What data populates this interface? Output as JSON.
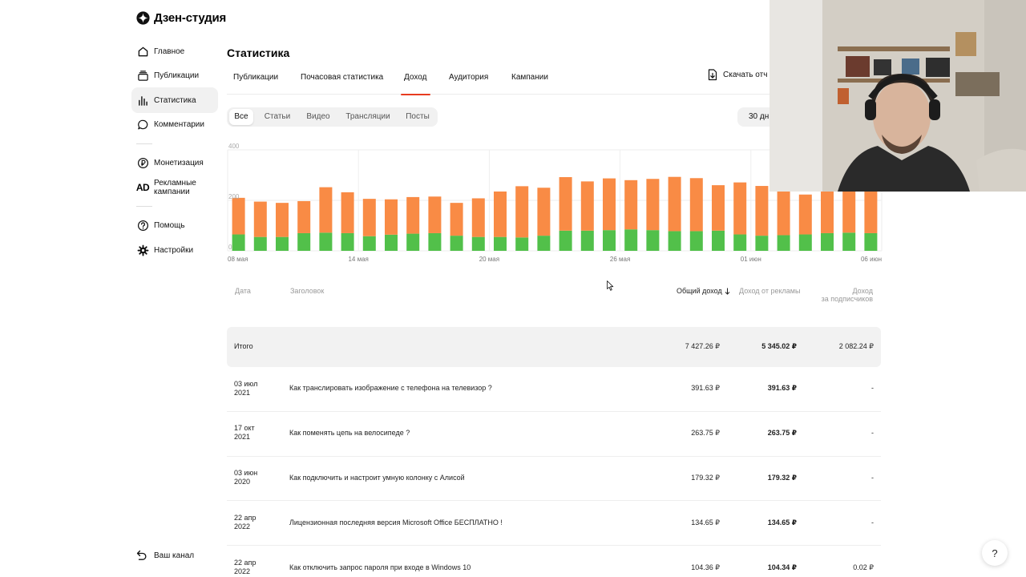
{
  "app": {
    "name": "Дзен-студия"
  },
  "sidebar": {
    "items": [
      {
        "label": "Главное",
        "icon": "home-icon"
      },
      {
        "label": "Публикации",
        "icon": "publications-icon"
      },
      {
        "label": "Статистика",
        "icon": "statistics-icon",
        "active": true
      },
      {
        "label": "Комментарии",
        "icon": "comments-icon"
      },
      {
        "label": "Монетизация",
        "icon": "ruble-icon"
      },
      {
        "label": "Рекламные\nкампании",
        "icon": "ad-icon",
        "icon_text": "AD"
      },
      {
        "label": "Помощь",
        "icon": "help-icon"
      },
      {
        "label": "Настройки",
        "icon": "gear-icon"
      }
    ],
    "your_channel": "Ваш канал"
  },
  "page": {
    "title": "Статистика",
    "tabs": [
      {
        "label": "Публикации"
      },
      {
        "label": "Почасовая статистика"
      },
      {
        "label": "Доход",
        "active": true
      },
      {
        "label": "Аудитория"
      },
      {
        "label": "Кампании"
      }
    ],
    "download_label": "Скачать отч",
    "filters": [
      "Все",
      "Статьи",
      "Видео",
      "Трансляции",
      "Посты"
    ],
    "active_filter": "Все",
    "period": "30 дн"
  },
  "colors": {
    "ads": "#f98b45",
    "subs": "#52c04a",
    "accent": "#e73b1f"
  },
  "chart_data": {
    "type": "bar",
    "stacked": true,
    "ylim": [
      0,
      400
    ],
    "yticks": [
      0,
      200,
      400
    ],
    "x_tick_labels": [
      "08 мая",
      "14 мая",
      "20 мая",
      "26 мая",
      "01 июн",
      "06 июн"
    ],
    "x_tick_index": [
      0,
      6,
      12,
      18,
      24,
      29
    ],
    "series": [
      {
        "name": "",
        "values": [
          65,
          55,
          55,
          70,
          72,
          70,
          58,
          64,
          68,
          70,
          60,
          55,
          55,
          53,
          60,
          80,
          80,
          82,
          85,
          82,
          78,
          78,
          80,
          65,
          60,
          62,
          65,
          70,
          72,
          70
        ]
      },
      {
        "name": "",
        "values": [
          145,
          140,
          135,
          127,
          180,
          162,
          148,
          140,
          145,
          145,
          130,
          153,
          180,
          203,
          190,
          212,
          195,
          205,
          195,
          203,
          215,
          210,
          180,
          206,
          197,
          177,
          158,
          171,
          193,
          183
        ]
      }
    ]
  },
  "table": {
    "headers": {
      "date": "Дата",
      "title": "Заголовок",
      "total": "Общий доход",
      "ads": "Доход от рекламы",
      "subs_line1": "Доход",
      "subs_line2": "за подписчиков"
    },
    "total_row": {
      "label": "Итого",
      "total": "7 427.26 ₽",
      "ads": "5 345.02 ₽",
      "subs": "2 082.24 ₽"
    },
    "rows": [
      {
        "date": "03 июл\n2021",
        "title": "Как транслировать изображение с телефона на телевизор ?",
        "total": "391.63 ₽",
        "ads": "391.63 ₽",
        "subs": "-"
      },
      {
        "date": "17 окт\n2021",
        "title": "Как поменять цепь на велосипеде ?",
        "total": "263.75 ₽",
        "ads": "263.75 ₽",
        "subs": "-"
      },
      {
        "date": "03 июн\n2020",
        "title": "Как подключить и настроит умную колонку с Алисой",
        "total": "179.32 ₽",
        "ads": "179.32 ₽",
        "subs": "-"
      },
      {
        "date": "22 апр\n2022",
        "title": "Лицензионная последняя версия Microsoft Office БЕСПЛАТНО !",
        "total": "134.65 ₽",
        "ads": "134.65 ₽",
        "subs": "-"
      },
      {
        "date": "22 апр\n2022",
        "title": "Как отключить запрос пароля при входе в Windows 10",
        "total": "104.36 ₽",
        "ads": "104.34 ₽",
        "subs": "0.02 ₽"
      }
    ]
  },
  "help_fab_label": "?"
}
